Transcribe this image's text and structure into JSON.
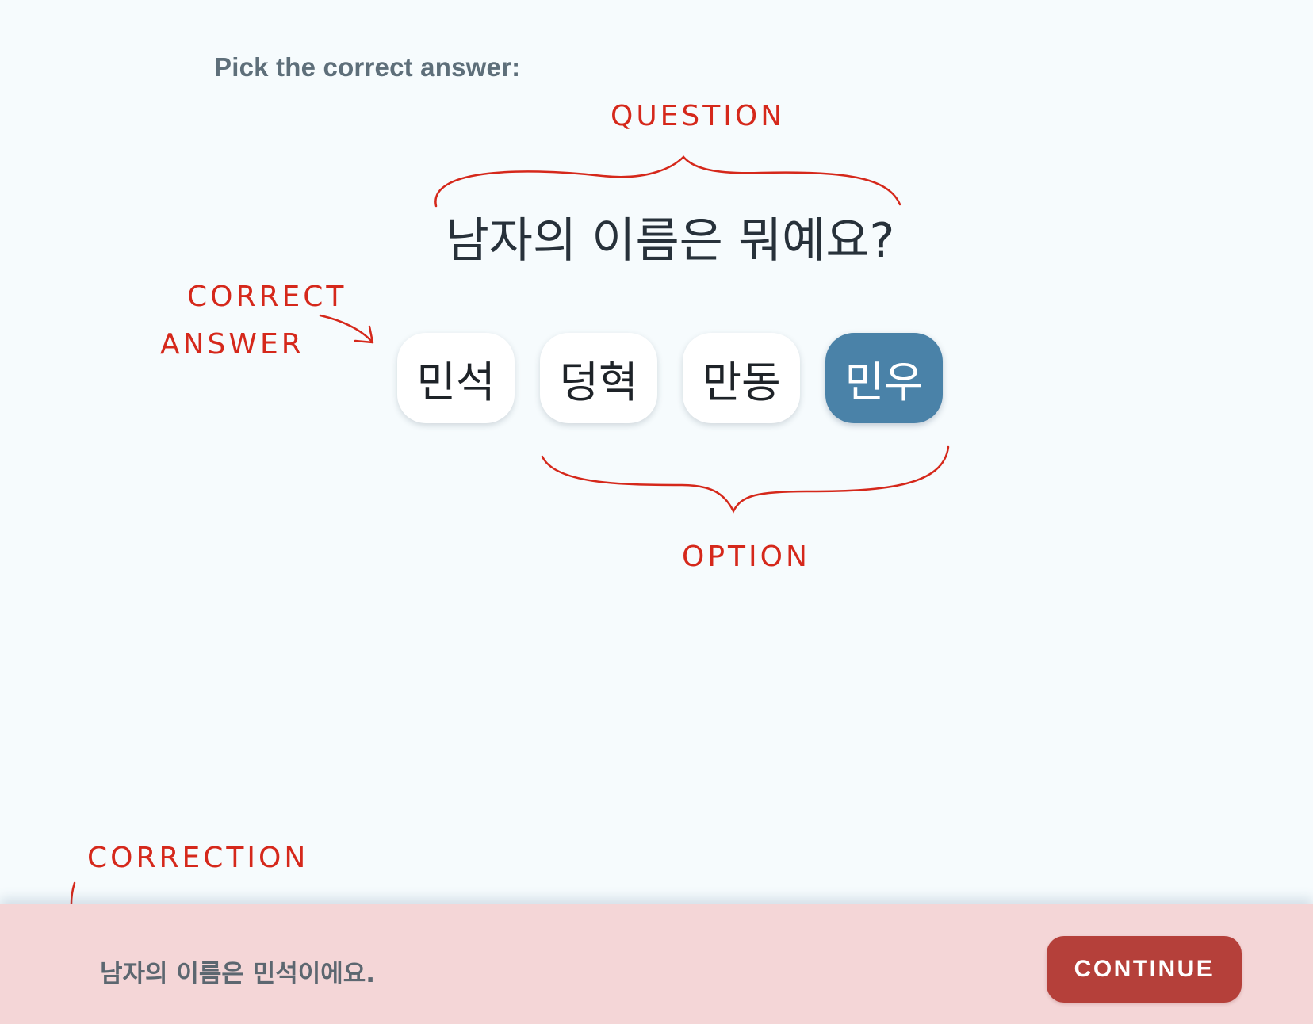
{
  "instruction": "Pick the correct answer:",
  "question": "남자의 이름은 뭐예요?",
  "options": [
    {
      "label": "민석",
      "selected": false
    },
    {
      "label": "덩혁",
      "selected": false
    },
    {
      "label": "만동",
      "selected": false
    },
    {
      "label": "민우",
      "selected": true
    }
  ],
  "annotations": {
    "question": "QUESTION",
    "correct_line1": "CORRECT",
    "correct_line2": "ANSWER",
    "option": "OPTION",
    "correction": "CORRECTION"
  },
  "footer": {
    "correction_text": "남자의 이름은 민석이에요.",
    "continue_label": "CONTINUE"
  },
  "colors": {
    "background": "#f6fbfd",
    "selected_option": "#4a82a8",
    "footer_background": "#f4d6d7",
    "continue_button": "#b5403a",
    "annotation": "#d5281b"
  }
}
